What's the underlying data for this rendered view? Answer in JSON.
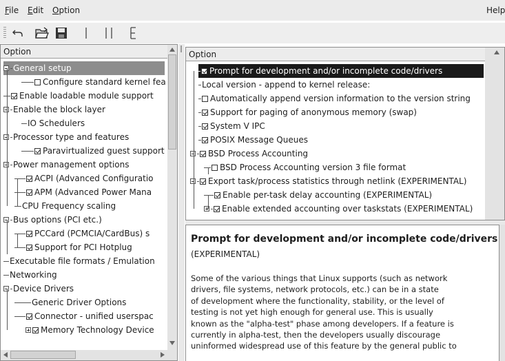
{
  "menubar": {
    "file": {
      "mnemonic": "F",
      "rest": "ile"
    },
    "edit": {
      "mnemonic": "E",
      "rest": "dit"
    },
    "option": {
      "mnemonic": "O",
      "rest": "ption"
    },
    "help": "Help"
  },
  "left_pane": {
    "header": "Option",
    "items": [
      {
        "label": "General setup",
        "state": "expanded",
        "selected": true
      },
      {
        "label": "Configure standard kernel fea",
        "state": "unchecked"
      },
      {
        "label": "Enable loadable module support",
        "state": "checked"
      },
      {
        "label": "Enable the block layer",
        "state": "expanded"
      },
      {
        "label": "IO Schedulers",
        "state": "none"
      },
      {
        "label": "Processor type and features",
        "state": "expanded"
      },
      {
        "label": "Paravirtualized guest support",
        "state": "checked"
      },
      {
        "label": "Power management options",
        "state": "expanded"
      },
      {
        "label": "ACPI (Advanced Configuratio",
        "state": "checked"
      },
      {
        "label": "APM (Advanced Power Mana",
        "state": "checked"
      },
      {
        "label": "CPU Frequency scaling",
        "state": "none"
      },
      {
        "label": "Bus options (PCI etc.)",
        "state": "expanded"
      },
      {
        "label": "PCCard (PCMCIA/CardBus) s",
        "state": "checked"
      },
      {
        "label": "Support for PCI Hotplug",
        "state": "checked"
      },
      {
        "label": "Executable file formats / Emulation",
        "state": "none"
      },
      {
        "label": "Networking",
        "state": "none"
      },
      {
        "label": "Device Drivers",
        "state": "expanded"
      },
      {
        "label": "Generic Driver Options",
        "state": "none"
      },
      {
        "label": "Connector - unified userspac",
        "state": "checked"
      },
      {
        "label": "Memory Technology Device",
        "state": "checked"
      }
    ]
  },
  "right_pane": {
    "header": "Option",
    "items": [
      {
        "label": "Prompt for development and/or incomplete code/drivers",
        "state": "checked",
        "selected": true
      },
      {
        "label": "Local version - append to kernel release:",
        "state": "none"
      },
      {
        "label": "Automatically append version information to the version string",
        "state": "unchecked"
      },
      {
        "label": "Support for paging of anonymous memory (swap)",
        "state": "checked"
      },
      {
        "label": "System V IPC",
        "state": "checked"
      },
      {
        "label": "POSIX Message Queues",
        "state": "checked"
      },
      {
        "label": "BSD Process Accounting",
        "state": "checked"
      },
      {
        "label": "BSD Process Accounting version 3 file format",
        "state": "unchecked"
      },
      {
        "label": "Export task/process statistics through netlink (EXPERIMENTAL)",
        "state": "checked"
      },
      {
        "label": "Enable per-task delay accounting (EXPERIMENTAL)",
        "state": "checked"
      },
      {
        "label": "Enable extended accounting over taskstats (EXPERIMENTAL)",
        "state": "checked"
      }
    ]
  },
  "help_pane": {
    "title": "Prompt for development and/or incomplete code/drivers",
    "subtitle": "(EXPERIMENTAL)",
    "lines": [
      "Some of the various things that Linux supports (such as network",
      "drivers, file systems, network protocols, etc.) can be in a state",
      "of development where the functionality, stability, or the level of",
      "testing is not yet high enough for general use. This is usually",
      "known as the \"alpha-test\" phase among developers. If a feature is",
      "currently in alpha-test, then the developers usually discourage",
      "uninformed widespread use of this feature by the general public to"
    ]
  },
  "toolbar": {
    "buttons": [
      "back-icon",
      "load-icon",
      "save-icon",
      "single-view-icon",
      "split-view-icon",
      "full-view-icon"
    ]
  }
}
